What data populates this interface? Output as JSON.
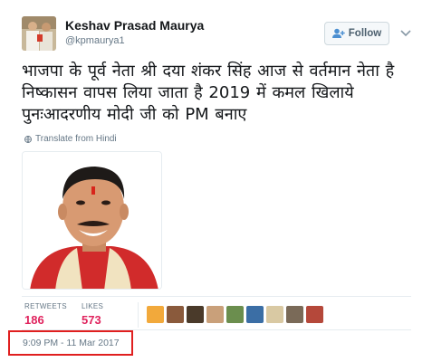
{
  "tweet": {
    "author_name": "Keshav Prasad Maurya",
    "author_handle": "@kpmaurya1",
    "follow_label": "Follow",
    "text": "भाजपा के पूर्व नेता श्री दया शंकर सिंह आज से वर्तमान नेता है निष्कासन वापस लिया जाता है 2019 में कमल खिलाये पुनःआदरणीय मोदी जी को PM बनाए",
    "translate_label": "Translate from Hindi",
    "retweets_label": "RETWEETS",
    "retweets_count": "186",
    "likes_label": "LIKES",
    "likes_count": "573",
    "timestamp": "9:09 PM - 11 Mar 2017"
  },
  "icons": {
    "follow": "person-plus-icon",
    "more": "chevron-down-icon",
    "translate": "globe-icon"
  },
  "colors": {
    "counts": "#e0245e",
    "highlight_box": "#e01f1f",
    "muted_text": "#657786"
  },
  "likers": [
    {
      "name": "liker-avatar-1",
      "color": "#f2a93b"
    },
    {
      "name": "liker-avatar-2",
      "color": "#8a5a3c"
    },
    {
      "name": "liker-avatar-3",
      "color": "#4a3a2a"
    },
    {
      "name": "liker-avatar-4",
      "color": "#c9a07a"
    },
    {
      "name": "liker-avatar-5",
      "color": "#6b8e4e"
    },
    {
      "name": "liker-avatar-6",
      "color": "#3b6ea5"
    },
    {
      "name": "liker-avatar-7",
      "color": "#d9c9a3"
    },
    {
      "name": "liker-avatar-8",
      "color": "#7a6a58"
    },
    {
      "name": "liker-avatar-9",
      "color": "#b5483a"
    }
  ]
}
